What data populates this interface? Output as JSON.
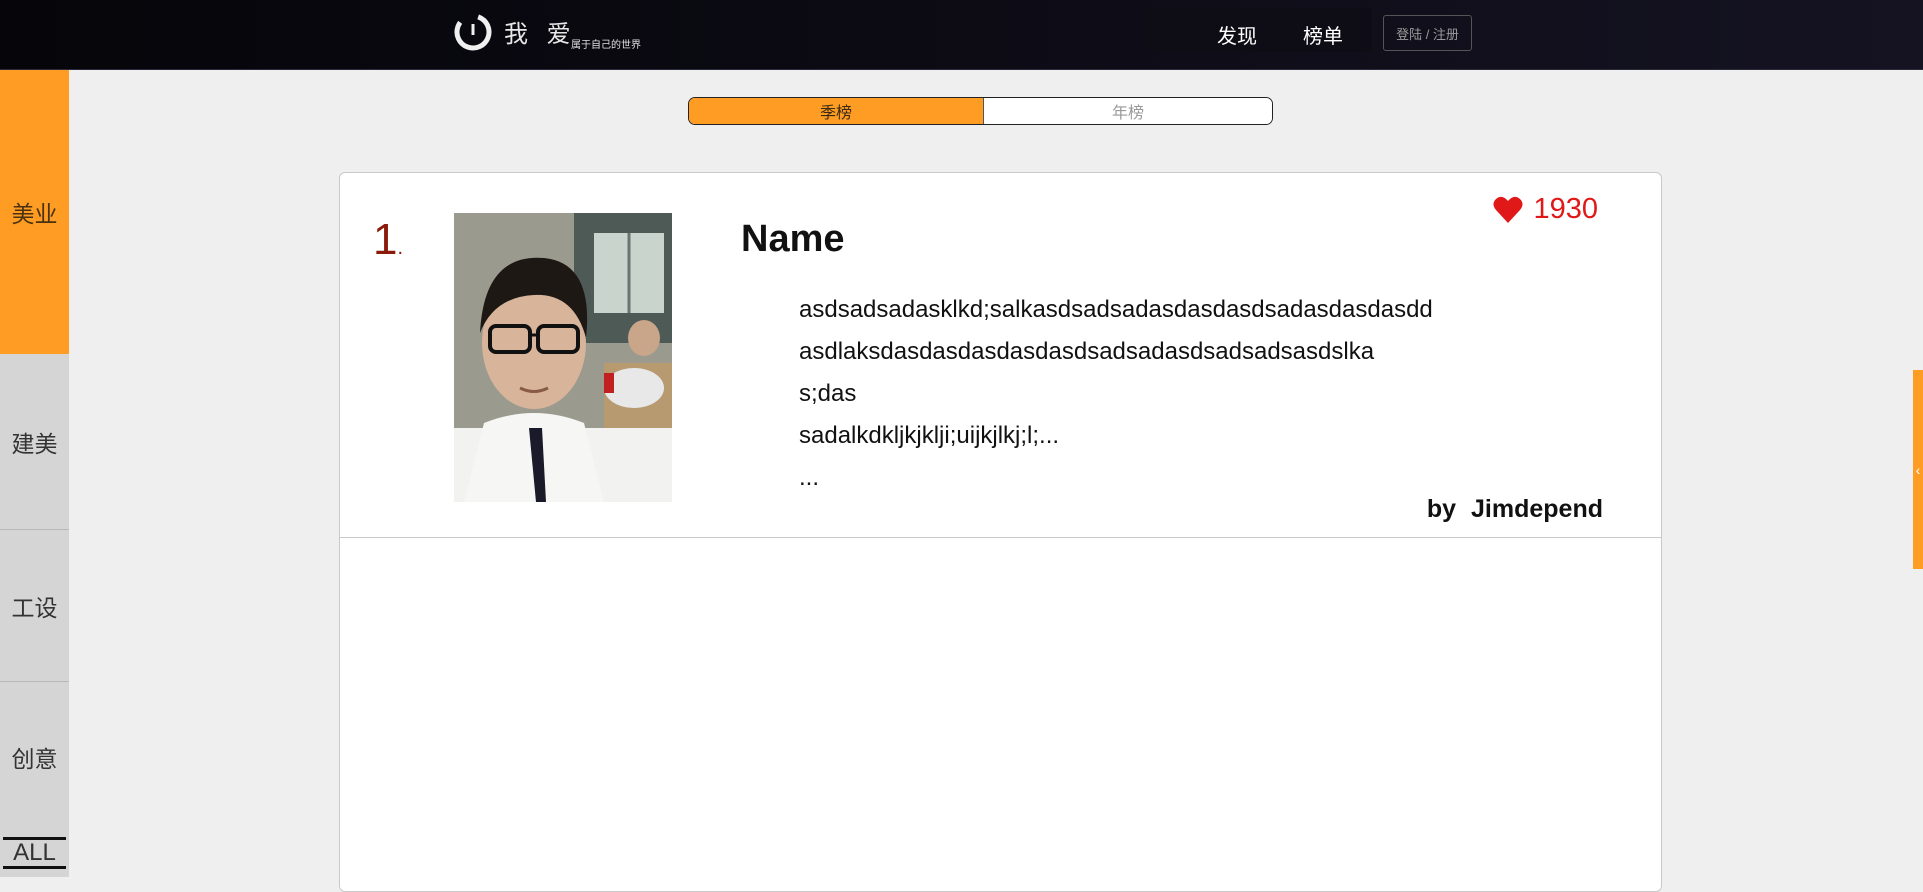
{
  "header": {
    "logo_text": "我 爱",
    "logo_subtitle": "属于自己的世界",
    "nav": [
      "发现",
      "榜单"
    ],
    "login_label": "登陆 / 注册"
  },
  "sidebar": {
    "items": [
      {
        "label": "美业",
        "active": true
      },
      {
        "label": "建美",
        "active": false
      },
      {
        "label": "工设",
        "active": false
      },
      {
        "label": "创意",
        "active": false
      }
    ],
    "all_label": "ALL"
  },
  "tabs": [
    {
      "label": "季榜",
      "active": true
    },
    {
      "label": "年榜",
      "active": false
    }
  ],
  "entry": {
    "rank": "1",
    "rank_suffix": ".",
    "name": "Name",
    "description": [
      "asdsadsadasklkd;salkasdsadsadasdasdasdsadasdasdasdd",
      "asdlaksdasdasdasdasdasdsadsadasdsadsadsasdslka",
      "s;das",
      "sadalkdkljkjklji;uijkjlkj;l;...",
      "..."
    ],
    "author_prefix": "by",
    "author": "Jimdepend",
    "likes": "1930",
    "like_icon": "heart-icon"
  },
  "side_tab_icon": "chevron-left-icon",
  "colors": {
    "accent": "#ff9c24",
    "heart": "#e01818",
    "topbar": "#0b0a12"
  }
}
